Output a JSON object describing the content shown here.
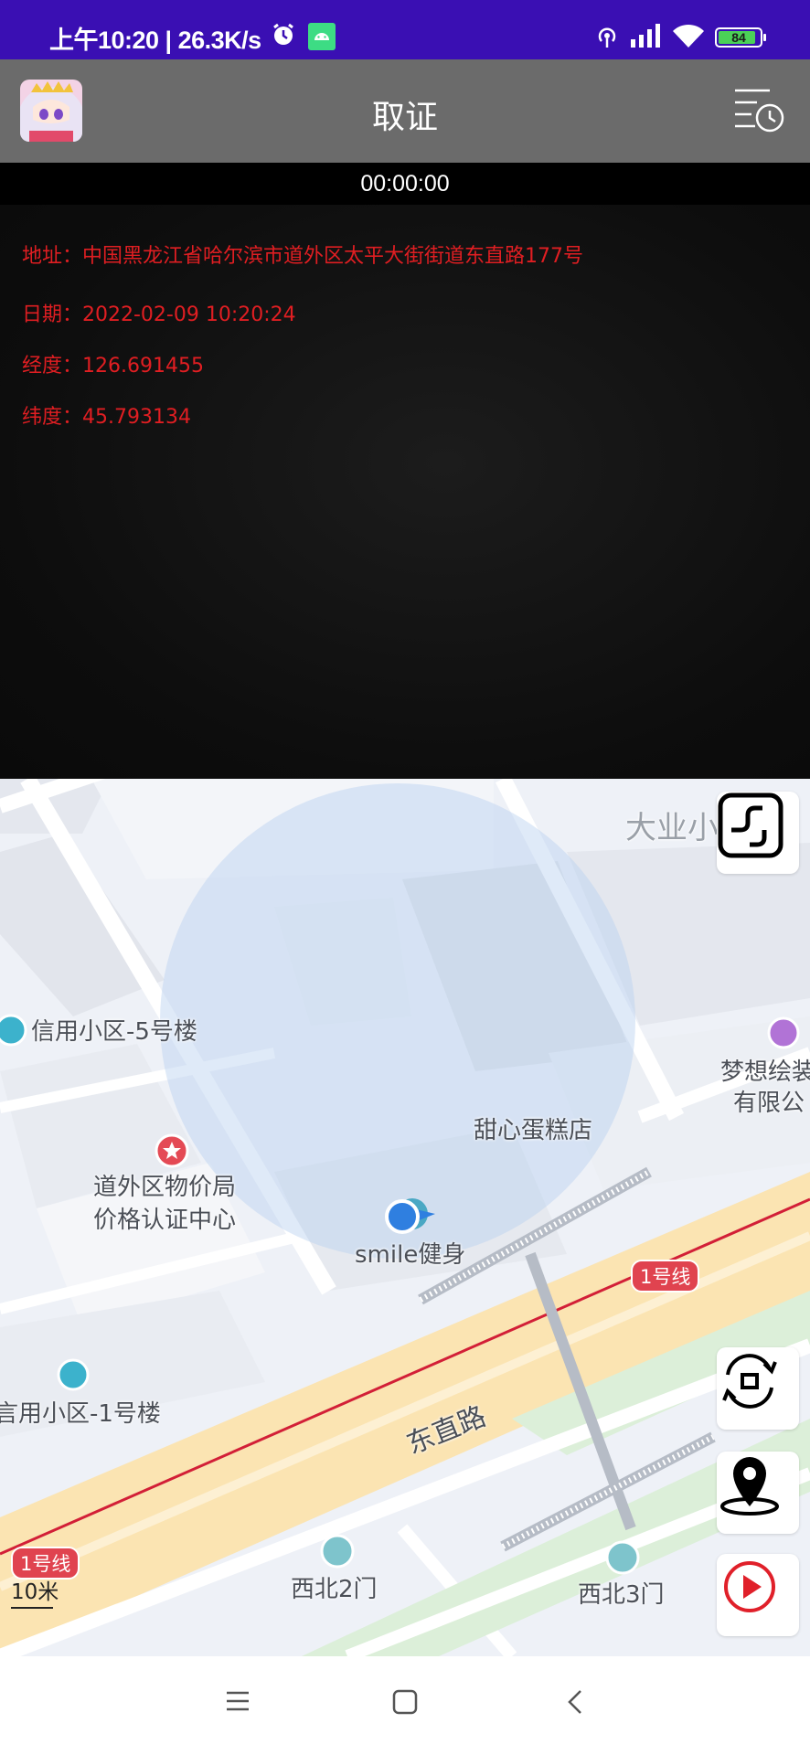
{
  "status_bar": {
    "time_speed": "上午10:20 | 26.3K/s",
    "battery_level": "84"
  },
  "app_bar": {
    "title": "取证"
  },
  "camera": {
    "timer": "00:00:00",
    "address": "地址：中国黑龙江省哈尔滨市道外区太平大街街道东直路177号",
    "date": "日期：2022-02-09 10:20:24",
    "longitude": "经度：126.691455",
    "latitude": "纬度：45.793134"
  },
  "map": {
    "labels": {
      "dayexiao": "大业小",
      "xinyong5": "信用小区-5号楼",
      "mengxiang1": "梦想绘装",
      "mengxiang2": "有限公",
      "tianxin": "甜心蛋糕店",
      "wujiaju1": "道外区物价局",
      "wujiaju2": "价格认证中心",
      "smile": "smile健身",
      "xinyong1": "言用小区-1号楼",
      "dongzhilu": "东直路",
      "xibei2": "西北2门",
      "xibei3": "西北3门"
    },
    "line_tags": [
      "1号线",
      "1号线"
    ],
    "scale": "10米"
  }
}
